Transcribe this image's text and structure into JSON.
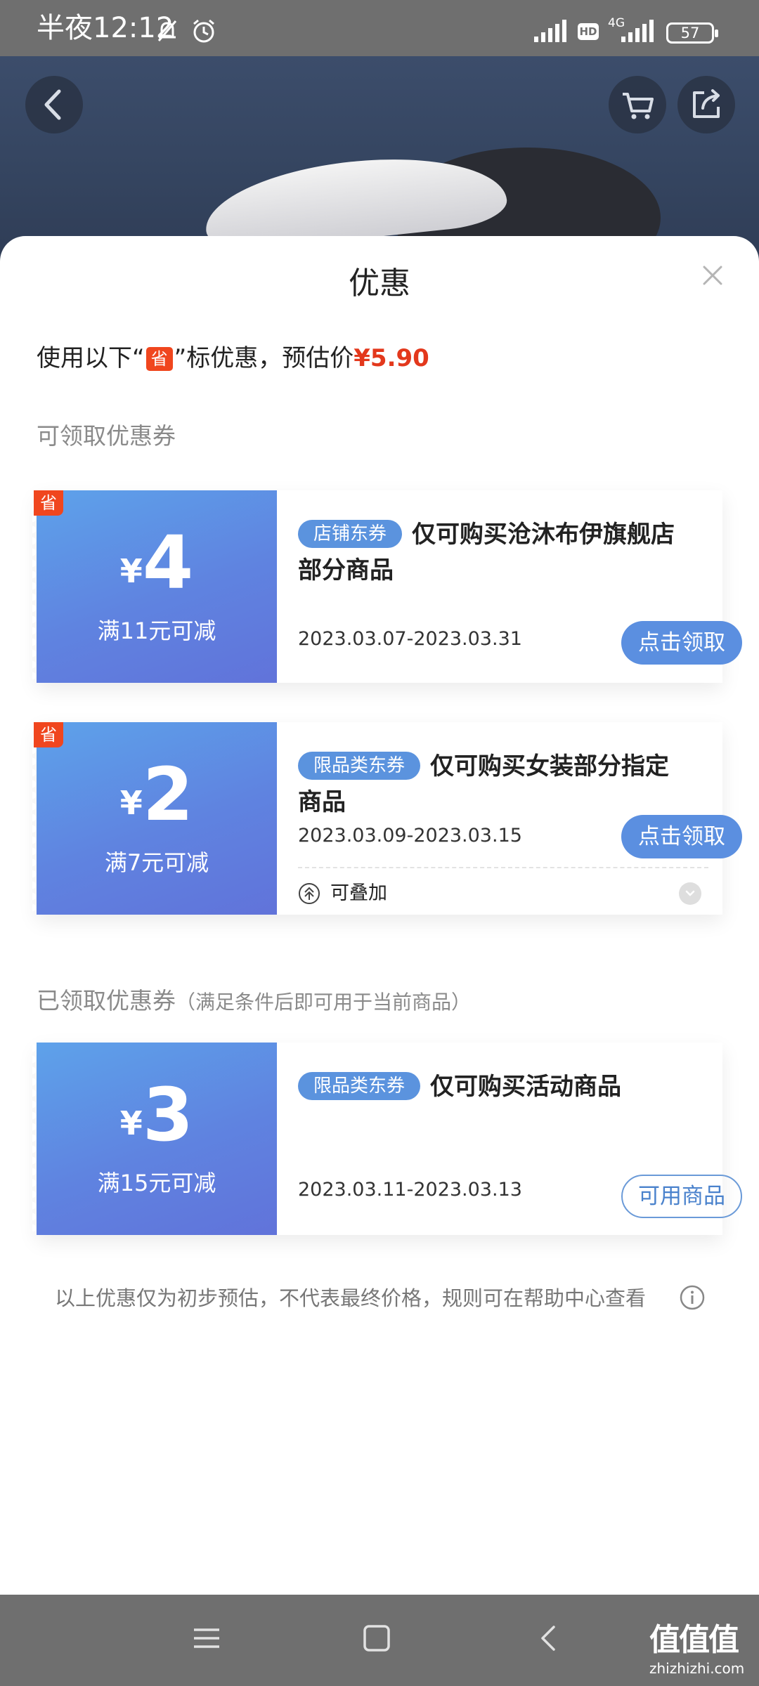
{
  "status_bar": {
    "time": "半夜12:12",
    "hd": "HD",
    "network": "4G",
    "battery": "57"
  },
  "sheet": {
    "title": "优惠",
    "estimate": {
      "prefix": "使用以下“",
      "tag": "省",
      "middle": "”标优惠，预估价",
      "price": "¥5.90"
    },
    "available_section": "可领取优惠券",
    "claimed_section": "已领取优惠券",
    "claimed_section_note": "（满足条件后即可用于当前商品）",
    "disclaimer": "以上优惠仅为初步预估，不代表最终价格，规则可在帮助中心查看"
  },
  "coupons": [
    {
      "sheng_tag": "省",
      "currency": "¥",
      "amount": "4",
      "condition": "满11元可减",
      "type": "店铺东券",
      "description": "仅可购买沧沐布伊旗舰店部分商品",
      "date": "2023.03.07-2023.03.31",
      "button": "点击领取"
    },
    {
      "sheng_tag": "省",
      "currency": "¥",
      "amount": "2",
      "condition": "满7元可减",
      "type": "限品类东券",
      "description": "仅可购买女装部分指定商品",
      "date": "2023.03.09-2023.03.15",
      "button": "点击领取",
      "stack_label": "可叠加"
    },
    {
      "currency": "¥",
      "amount": "3",
      "condition": "满15元可减",
      "type": "限品类东券",
      "description": "仅可购买活动商品",
      "date": "2023.03.11-2023.03.13",
      "button": "可用商品"
    }
  ],
  "watermark": {
    "main": "值值值",
    "sub": "zhizhizhi.com"
  },
  "icons": {
    "back": "chevron-left-icon",
    "cart": "cart-icon",
    "share": "share-icon",
    "close": "close-icon",
    "info": "info-icon",
    "stack": "stack-icon",
    "expand": "chevron-down-icon"
  },
  "colors": {
    "accent_red": "#e3381c",
    "sheng_tag": "#f0461e",
    "coupon_blue": "#5f83e0",
    "button_blue": "#5b8fe0"
  }
}
